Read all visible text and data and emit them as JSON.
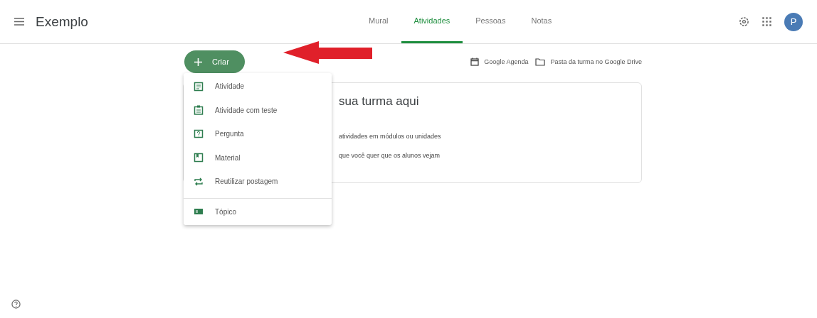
{
  "header": {
    "title": "Exemplo",
    "tabs": [
      {
        "label": "Mural",
        "selected": false
      },
      {
        "label": "Atividades",
        "selected": true
      },
      {
        "label": "Pessoas",
        "selected": false
      },
      {
        "label": "Notas",
        "selected": false
      }
    ],
    "avatar": "P"
  },
  "toolbar": {
    "create_button": "Criar",
    "links": [
      "Google Agenda",
      "Pasta da turma no Google Drive"
    ]
  },
  "card": {
    "title": "sua turma aqui",
    "lines": [
      "atividades em módulos ou unidades",
      "que você quer que os alunos vejam"
    ]
  },
  "menu": {
    "items": [
      {
        "label": "Atividade",
        "kind": "assignment"
      },
      {
        "label": "Atividade com teste",
        "kind": "quiz"
      },
      {
        "label": "Pergunta",
        "kind": "question"
      },
      {
        "label": "Material",
        "kind": "material"
      },
      {
        "label": "Reutilizar postagem",
        "kind": "reuse"
      },
      {
        "label": "Tópico",
        "kind": "topic"
      }
    ]
  }
}
